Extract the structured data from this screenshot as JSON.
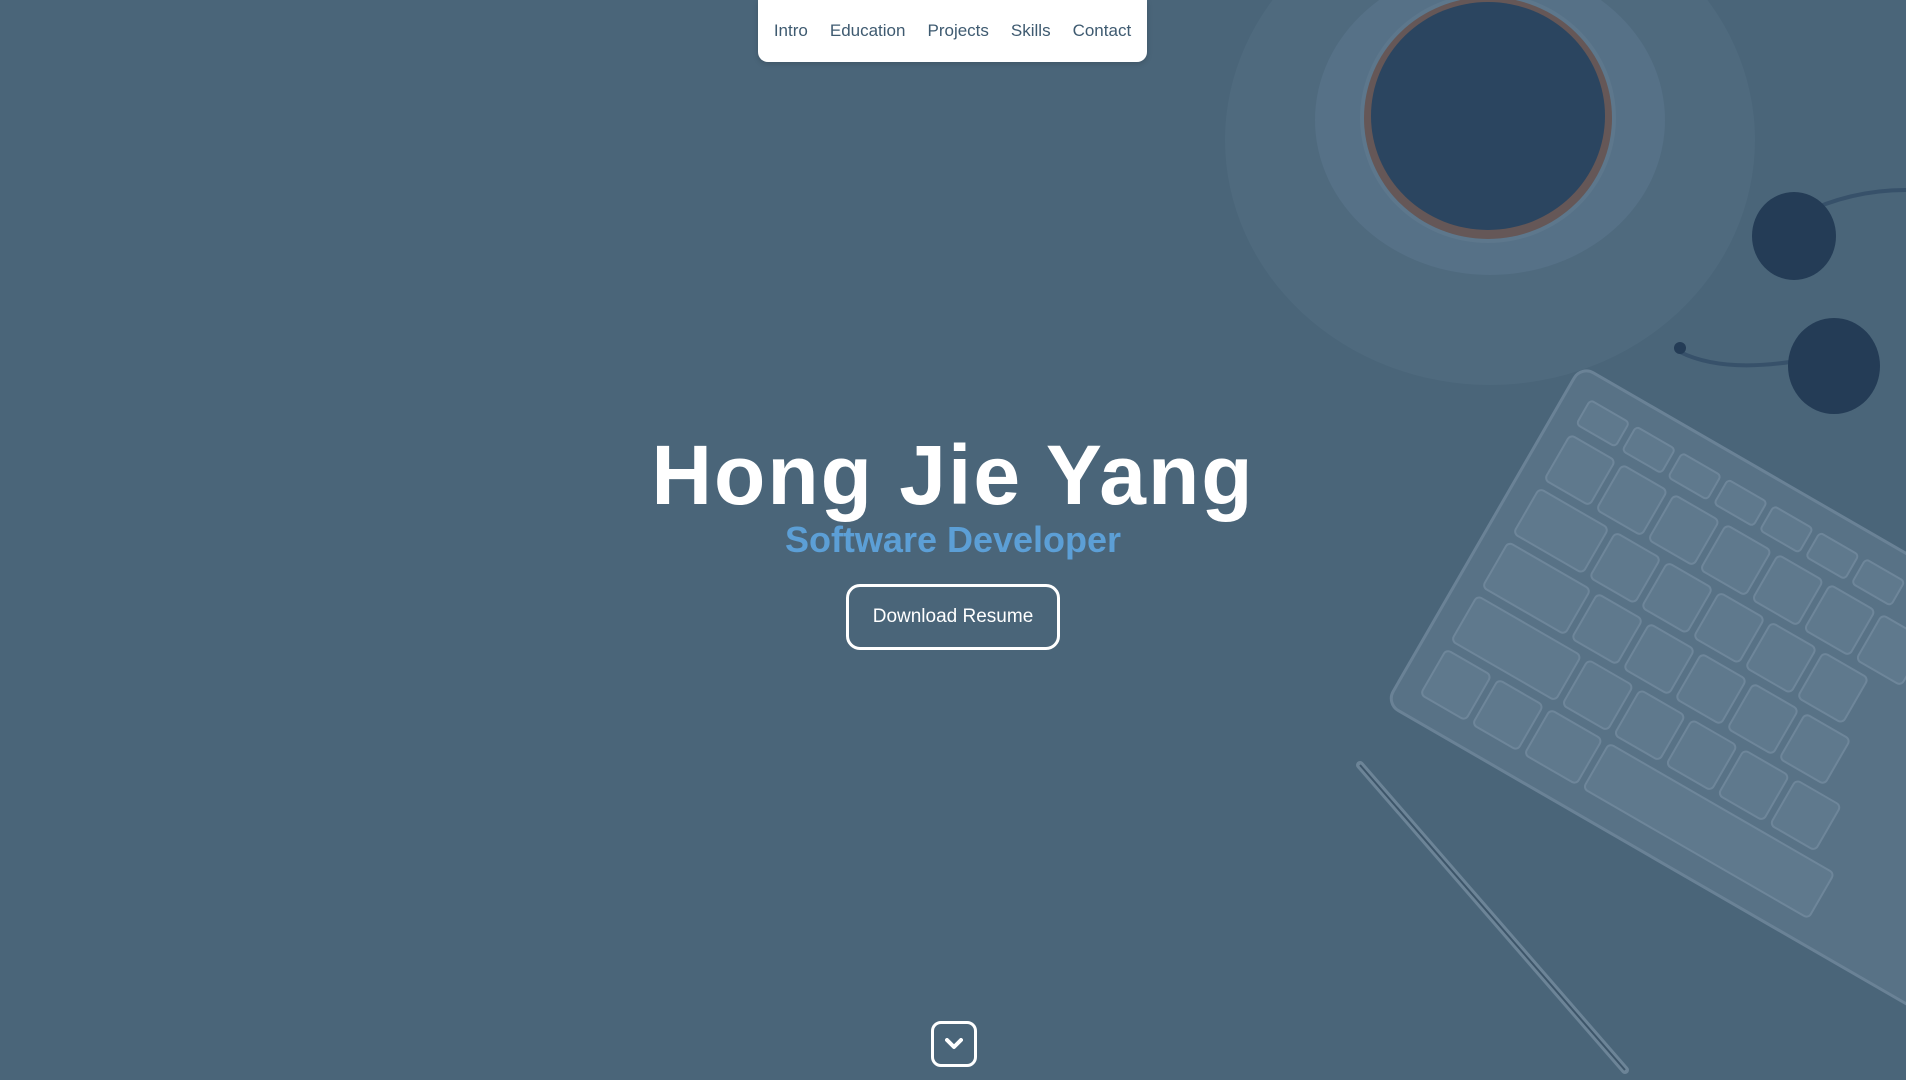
{
  "nav": {
    "items": [
      {
        "label": "Intro"
      },
      {
        "label": "Education"
      },
      {
        "label": "Projects"
      },
      {
        "label": "Skills"
      },
      {
        "label": "Contact"
      }
    ]
  },
  "hero": {
    "name": "Hong Jie Yang",
    "role": "Software Developer",
    "resume_button": "Download Resume",
    "scroll_icon": "chevron-down-icon"
  },
  "colors": {
    "background": "#4a6579",
    "accent": "#5c9fd6",
    "nav_text": "#3e5a70",
    "text": "#ffffff"
  }
}
